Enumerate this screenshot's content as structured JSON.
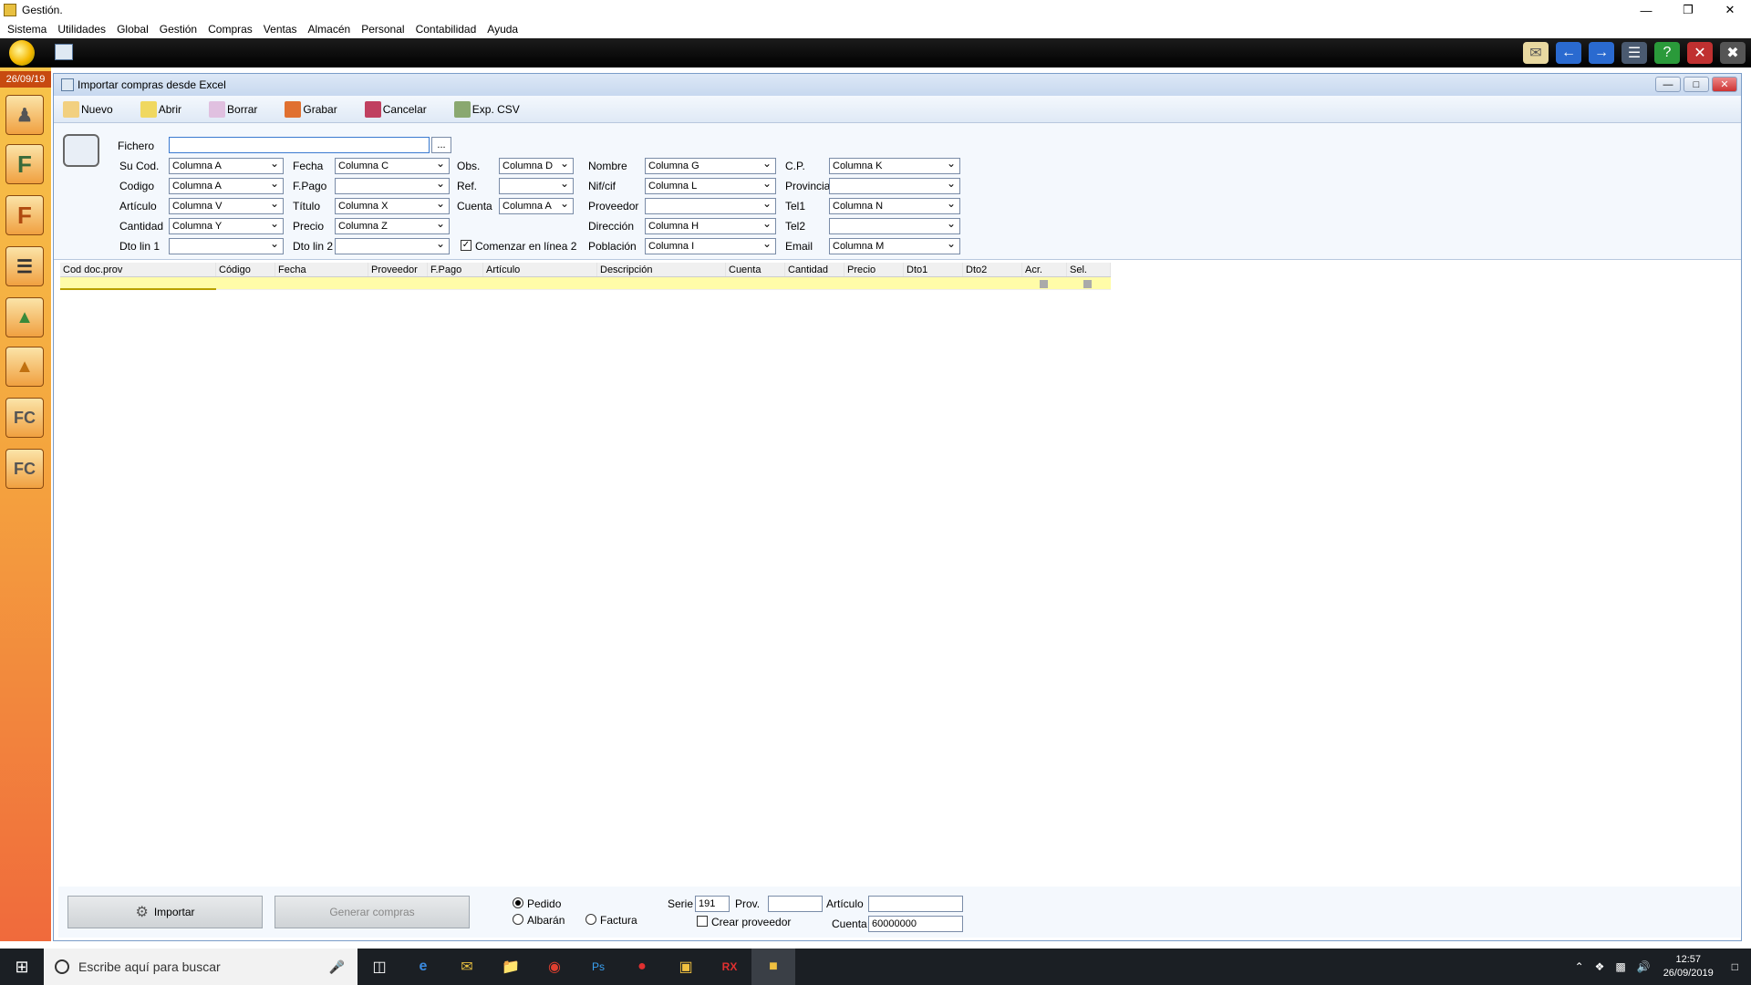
{
  "app": {
    "title": "Gestión."
  },
  "menu": [
    "Sistema",
    "Utilidades",
    "Global",
    "Gestión",
    "Compras",
    "Ventas",
    "Almacén",
    "Personal",
    "Contabilidad",
    "Ayuda"
  ],
  "sidebar": {
    "date": "26/09/19"
  },
  "window": {
    "title": "Importar compras desde Excel",
    "toolbar": [
      "Nuevo",
      "Abrir",
      "Borrar",
      "Grabar",
      "Cancelar",
      "Exp. CSV"
    ]
  },
  "form": {
    "fichero_label": "Fichero",
    "fichero_value": "",
    "browse": "...",
    "col1": [
      {
        "label": "Su Cod.",
        "value": "Columna A"
      },
      {
        "label": "Codigo",
        "value": "Columna A"
      },
      {
        "label": "Artículo",
        "value": "Columna V"
      },
      {
        "label": "Cantidad",
        "value": "Columna Y"
      },
      {
        "label": "Dto lin 1",
        "value": ""
      }
    ],
    "col2": [
      {
        "label": "Fecha",
        "value": "Columna C"
      },
      {
        "label": "F.Pago",
        "value": ""
      },
      {
        "label": "Título",
        "value": "Columna X"
      },
      {
        "label": "Precio",
        "value": "Columna Z"
      },
      {
        "label": "Dto lin 2",
        "value": ""
      }
    ],
    "col3": [
      {
        "label": "Obs.",
        "value": "Columna D"
      },
      {
        "label": "Ref.",
        "value": ""
      },
      {
        "label": "Cuenta",
        "value": "Columna A"
      }
    ],
    "comenzar": "Comenzar en línea 2",
    "col4": [
      {
        "label": "Nombre",
        "value": "Columna G"
      },
      {
        "label": "Nif/cif",
        "value": "Columna L"
      },
      {
        "label": "Proveedor",
        "value": ""
      },
      {
        "label": "Dirección",
        "value": "Columna H"
      },
      {
        "label": "Población",
        "value": "Columna I"
      }
    ],
    "col5": [
      {
        "label": "C.P.",
        "value": "Columna K"
      },
      {
        "label": "Provincia",
        "value": ""
      },
      {
        "label": "Tel1",
        "value": "Columna N"
      },
      {
        "label": "Tel2",
        "value": ""
      },
      {
        "label": "Email",
        "value": "Columna M"
      }
    ]
  },
  "grid": {
    "columns": [
      "Cod doc.prov",
      "Código",
      "Fecha",
      "Proveedor",
      "F.Pago",
      "Artículo",
      "Descripción",
      "Cuenta",
      "Cantidad",
      "Precio",
      "Dto1",
      "Dto2",
      "Acr.",
      "Sel."
    ]
  },
  "bottom": {
    "importar": "Importar",
    "generar": "Generar compras",
    "pedido": "Pedido",
    "albaran": "Albarán",
    "factura": "Factura",
    "serie_label": "Serie",
    "serie_value": "191",
    "prov_label": "Prov.",
    "prov_value": "",
    "articulo_label": "Artículo",
    "articulo_value": "",
    "crear_proveedor": "Crear proveedor",
    "cuenta_label": "Cuenta",
    "cuenta_value": "60000000"
  },
  "taskbar": {
    "search_placeholder": "Escribe aquí para buscar",
    "time": "12:57",
    "date": "26/09/2019"
  }
}
